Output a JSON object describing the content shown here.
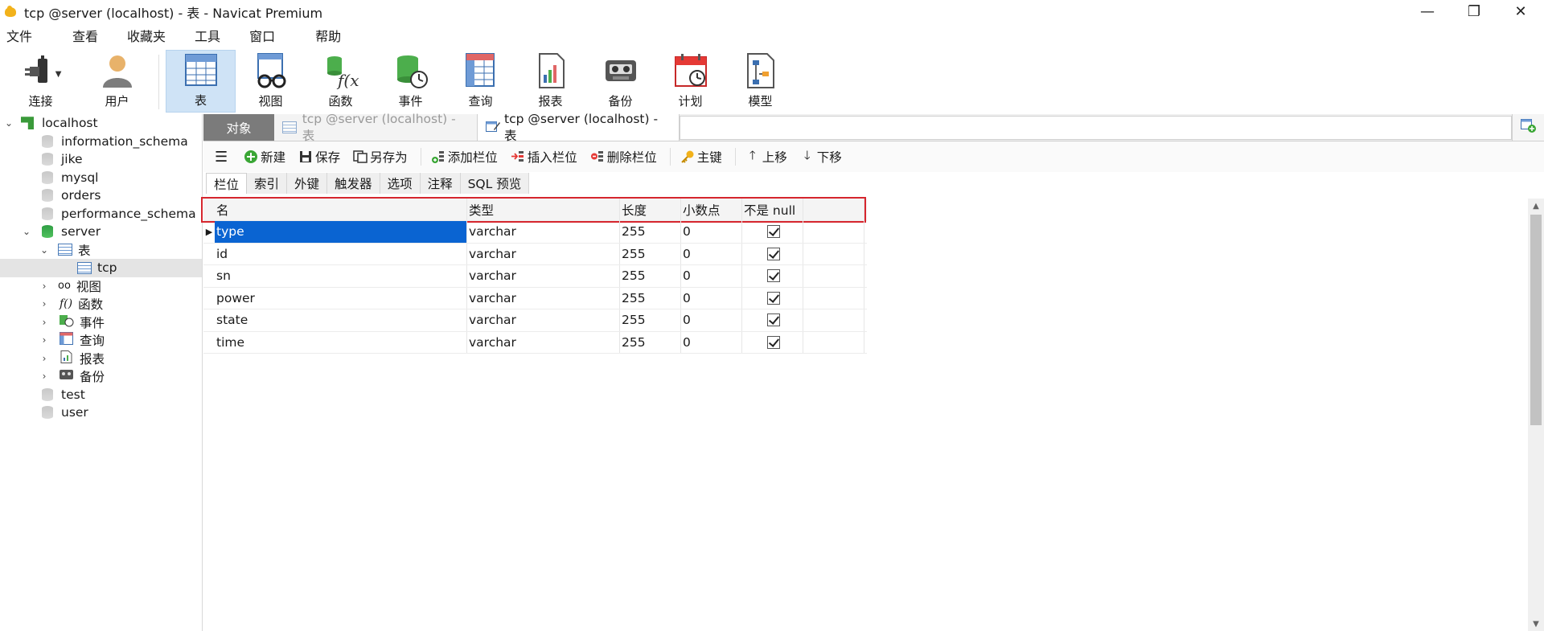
{
  "window": {
    "title": "tcp @server (localhost) - 表 - Navicat Premium",
    "controls": {
      "minimize": "—",
      "restore": "❐",
      "close": "✕"
    }
  },
  "menu": [
    "文件",
    "查看",
    "收藏夹",
    "工具",
    "窗口",
    "帮助"
  ],
  "toolbar": [
    {
      "label": "连接",
      "icon": "plug-icon"
    },
    {
      "label": "用户",
      "icon": "user-icon"
    },
    {
      "label": "表",
      "icon": "table-icon",
      "active": true
    },
    {
      "label": "视图",
      "icon": "view-glasses-icon"
    },
    {
      "label": "函数",
      "icon": "function-icon"
    },
    {
      "label": "事件",
      "icon": "event-icon"
    },
    {
      "label": "查询",
      "icon": "query-icon"
    },
    {
      "label": "报表",
      "icon": "report-icon"
    },
    {
      "label": "备份",
      "icon": "backup-icon"
    },
    {
      "label": "计划",
      "icon": "schedule-icon"
    },
    {
      "label": "模型",
      "icon": "model-icon"
    }
  ],
  "tree": {
    "connection": "localhost",
    "databases_top": [
      "information_schema",
      "jike",
      "mysql",
      "orders",
      "performance_schema"
    ],
    "server": "server",
    "tables_label": "表",
    "table_selected": "tcp",
    "server_children": [
      "视图",
      "函数",
      "事件",
      "查询",
      "报表",
      "备份"
    ],
    "databases_bottom": [
      "test",
      "user"
    ]
  },
  "tabs": {
    "objects": "对象",
    "inactive": "tcp @server (localhost) - 表",
    "current": "tcp @server (localhost) - 表"
  },
  "designer_toolbar": {
    "new": "新建",
    "save": "保存",
    "save_as": "另存为",
    "add_field": "添加栏位",
    "insert_field": "插入栏位",
    "delete_field": "删除栏位",
    "primary_key": "主键",
    "move_up": "上移",
    "move_down": "下移"
  },
  "subtabs": [
    "栏位",
    "索引",
    "外键",
    "触发器",
    "选项",
    "注释",
    "SQL 预览"
  ],
  "grid": {
    "headers": {
      "name": "名",
      "type": "类型",
      "length": "长度",
      "decimals": "小数点",
      "not_null": "不是 null"
    },
    "rows": [
      {
        "name": "type",
        "type": "varchar",
        "length": "255",
        "decimals": "0",
        "not_null": true
      },
      {
        "name": "id",
        "type": "varchar",
        "length": "255",
        "decimals": "0",
        "not_null": true
      },
      {
        "name": "sn",
        "type": "varchar",
        "length": "255",
        "decimals": "0",
        "not_null": true
      },
      {
        "name": "power",
        "type": "varchar",
        "length": "255",
        "decimals": "0",
        "not_null": true
      },
      {
        "name": "state",
        "type": "varchar",
        "length": "255",
        "decimals": "0",
        "not_null": true
      },
      {
        "name": "time",
        "type": "varchar",
        "length": "255",
        "decimals": "0",
        "not_null": true
      }
    ]
  },
  "colors": {
    "selection": "#0a64d2",
    "highlight_box": "#d6262e",
    "active_tool": "#cfe3f6"
  }
}
